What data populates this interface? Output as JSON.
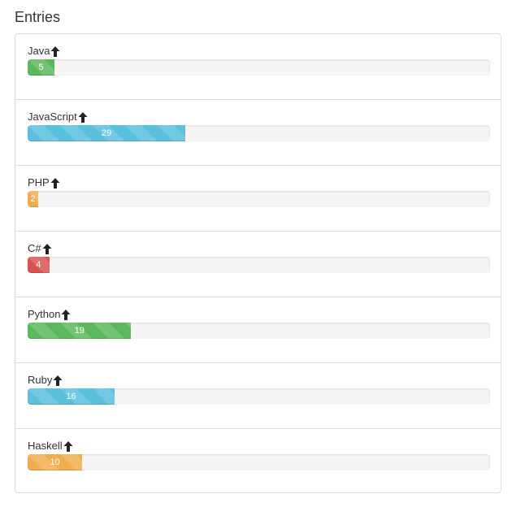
{
  "header": {
    "title": "Entries"
  },
  "colors": {
    "success": "#5cb85c",
    "info": "#5bc0de",
    "warning": "#f0ad4e",
    "danger": "#d9534f"
  },
  "entries": [
    {
      "name": "Java",
      "value": "5",
      "fraction": 0.058,
      "color": "#5cb85c",
      "icon": "arrow-up-icon"
    },
    {
      "name": "JavaScript",
      "value": "29",
      "fraction": 0.341,
      "color": "#5bc0de",
      "icon": "arrow-up-icon"
    },
    {
      "name": "PHP",
      "value": "2",
      "fraction": 0.023,
      "color": "#f0ad4e",
      "icon": "arrow-up-icon"
    },
    {
      "name": "C#",
      "value": "4",
      "fraction": 0.047,
      "color": "#d9534f",
      "icon": "arrow-up-icon"
    },
    {
      "name": "Python",
      "value": "19",
      "fraction": 0.224,
      "color": "#5cb85c",
      "icon": "arrow-up-icon"
    },
    {
      "name": "Ruby",
      "value": "16",
      "fraction": 0.188,
      "color": "#5bc0de",
      "icon": "arrow-up-icon"
    },
    {
      "name": "Haskell",
      "value": "10",
      "fraction": 0.118,
      "color": "#f0ad4e",
      "icon": "arrow-up-icon"
    }
  ]
}
